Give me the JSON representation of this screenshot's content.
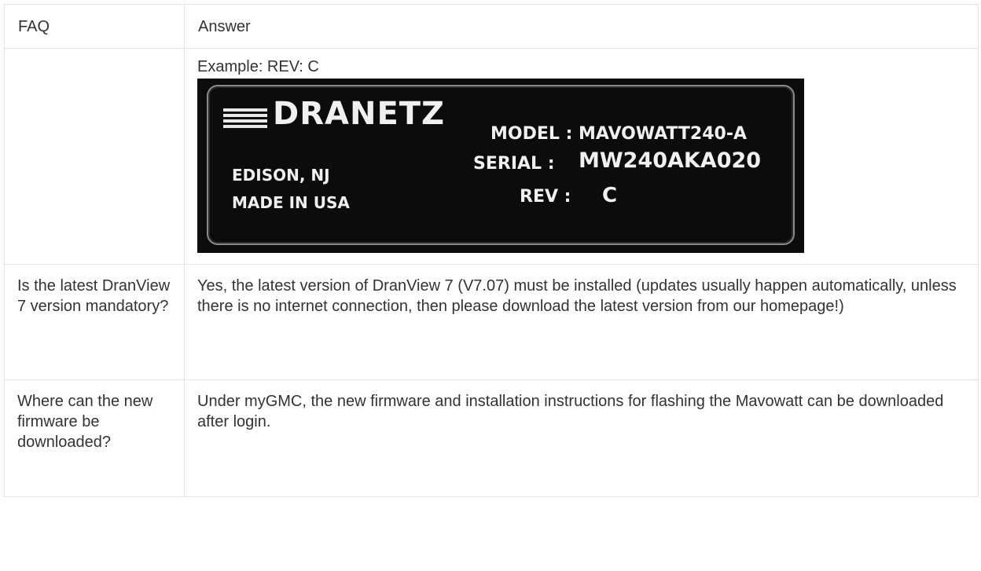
{
  "table": {
    "headers": {
      "faq": "FAQ",
      "answer": "Answer"
    },
    "example_label": "Example: REV: C",
    "nameplate": {
      "brand": "DRANETZ",
      "model_line": "MODEL : MAVOWATT240-A",
      "serial_label": "SERIAL :",
      "serial_value": "MW240AKA020",
      "rev_label": "REV :",
      "rev_value": "C",
      "city": "EDISON, NJ",
      "origin": "MADE IN USA"
    },
    "rows": [
      {
        "question": "Is the latest DranView 7 version mandatory?",
        "answer": "Yes, the latest version of DranView 7 (V7.07) must be installed (updates usually happen automatically, unless there is no internet connection, then please download the latest version from our homepage!)"
      },
      {
        "question": "Where can the new firmware be downloaded?",
        "answer": "Under myGMC, the new firmware and installation instructions for flashing the Mavowatt can be downloaded after login."
      }
    ]
  }
}
